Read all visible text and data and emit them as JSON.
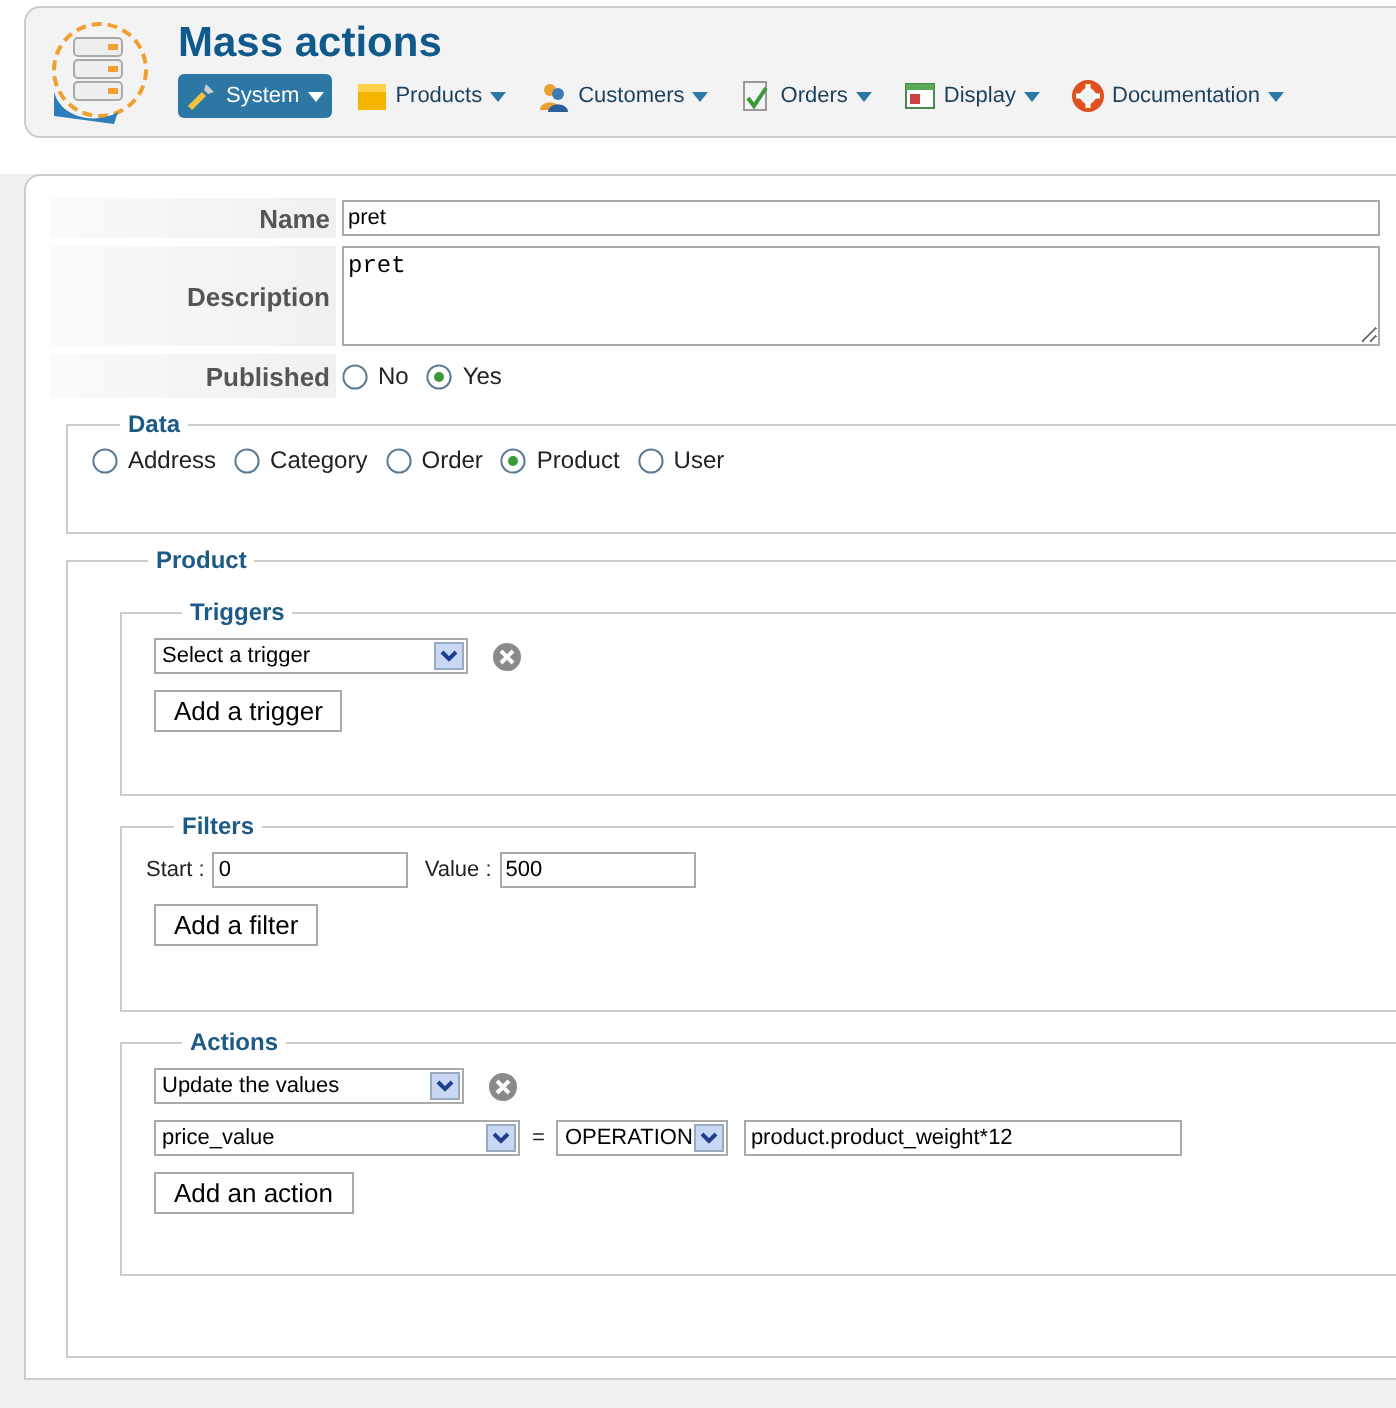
{
  "header": {
    "title": "Mass actions",
    "menu": [
      {
        "label": "System",
        "selected": true
      },
      {
        "label": "Products",
        "selected": false
      },
      {
        "label": "Customers",
        "selected": false
      },
      {
        "label": "Orders",
        "selected": false
      },
      {
        "label": "Display",
        "selected": false
      },
      {
        "label": "Documentation",
        "selected": false
      }
    ]
  },
  "form": {
    "name": {
      "label": "Name",
      "value": "pret"
    },
    "description": {
      "label": "Description",
      "value": "pret"
    },
    "published": {
      "label": "Published",
      "options": [
        {
          "label": "No",
          "selected": false
        },
        {
          "label": "Yes",
          "selected": true
        }
      ]
    }
  },
  "data": {
    "legend": "Data",
    "options": [
      {
        "label": "Address",
        "selected": false
      },
      {
        "label": "Category",
        "selected": false
      },
      {
        "label": "Order",
        "selected": false
      },
      {
        "label": "Product",
        "selected": true
      },
      {
        "label": "User",
        "selected": false
      }
    ]
  },
  "product": {
    "legend": "Product",
    "triggers": {
      "legend": "Triggers",
      "select": "Select a trigger",
      "button": "Add a trigger"
    },
    "filters": {
      "legend": "Filters",
      "fields": [
        {
          "label": "Start :",
          "value": "0"
        },
        {
          "label": "Value :",
          "value": "500"
        }
      ],
      "button": "Add a filter"
    },
    "actions": {
      "legend": "Actions",
      "select": "Update the values",
      "column": "price_value",
      "equals": "=",
      "operation": "OPERATION",
      "formula": "product.product_weight*12",
      "button": "Add an action"
    }
  }
}
